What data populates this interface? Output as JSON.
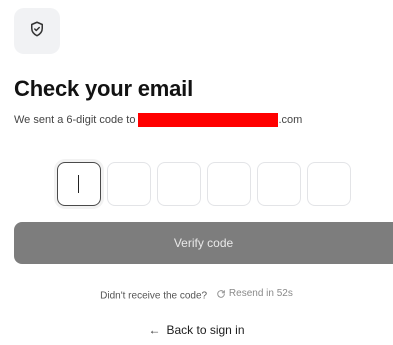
{
  "header": {
    "icon": "shield-check-icon",
    "title": "Check your email",
    "subtitle_prefix": "We sent a 6-digit code to",
    "email_suffix": ".com"
  },
  "otp": {
    "digits": [
      "",
      "",
      "",
      "",
      "",
      ""
    ],
    "active_index": 0
  },
  "verify": {
    "label": "Verify code"
  },
  "resend": {
    "prompt": "Didn't receive the code?",
    "icon": "refresh-icon",
    "action_label": "Resend in 52s"
  },
  "back": {
    "icon": "arrow-left-icon",
    "label": "Back to sign in"
  },
  "colors": {
    "button_bg": "#7d7d7d",
    "redaction": "#ff0000",
    "tile_bg": "#f1f2f4"
  }
}
